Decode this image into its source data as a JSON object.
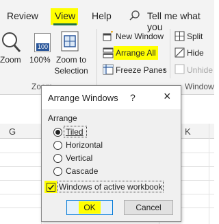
{
  "ribbon": {
    "tabs": {
      "review": "Review",
      "view": "View",
      "help": "Help"
    },
    "search": {
      "icon": "lightbulb-search-icon",
      "text": "Tell me what you"
    },
    "zoom_group": {
      "zoom_label": "Zoom",
      "hundred_label": "100%",
      "hundred_badge": "100",
      "zoom_to_selection_line1": "Zoom to",
      "zoom_to_selection_line2": "Selection",
      "group_label": "Zoom"
    },
    "window_group": {
      "new_window": "New Window",
      "arrange_all": "Arrange All",
      "freeze_panes": "Freeze Panes",
      "split": "Split",
      "hide": "Hide",
      "unhide": "Unhide",
      "group_label": "Window"
    }
  },
  "sheet": {
    "columns": [
      "G",
      "K"
    ]
  },
  "dialog": {
    "title": "Arrange Windows",
    "help": "?",
    "close": "×",
    "section_label": "Arrange",
    "options": [
      {
        "label": "Tiled",
        "selected": true
      },
      {
        "label": "Horizontal",
        "selected": false
      },
      {
        "label": "Vertical",
        "selected": false
      },
      {
        "label": "Cascade",
        "selected": false
      }
    ],
    "checkbox_label": "Windows of active workbook",
    "checkbox_checked": true,
    "ok_label": "OK",
    "cancel_label": "Cancel"
  },
  "colors": {
    "highlight": "#ffff00",
    "excel_green": "#217346",
    "icon_blue": "#2b579a"
  }
}
